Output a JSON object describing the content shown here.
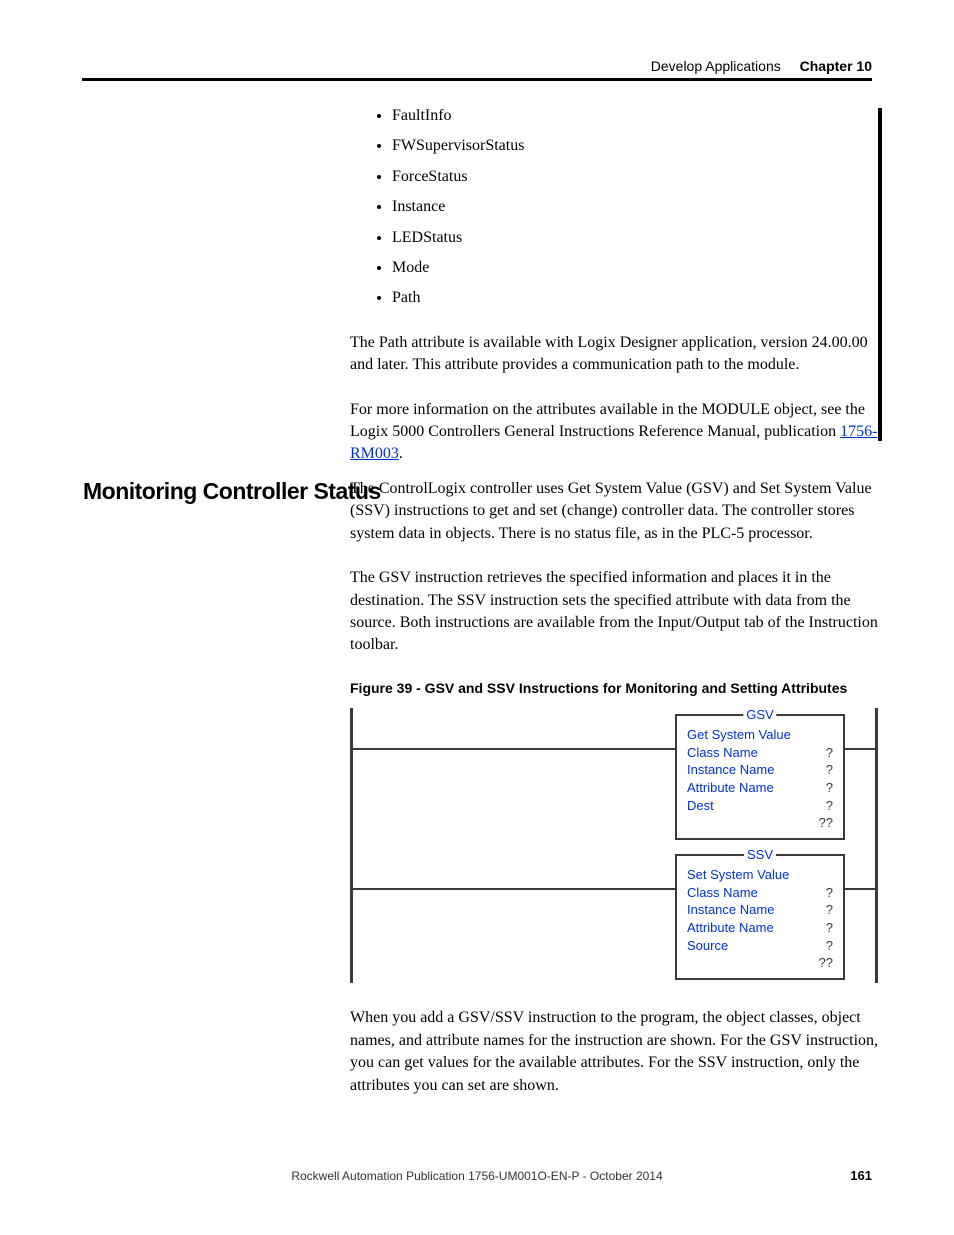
{
  "header": {
    "chapter_title": "Develop Applications",
    "chapter_label": "Chapter 10"
  },
  "attributes_list": [
    "FaultInfo",
    "FWSupervisorStatus",
    "ForceStatus",
    "Instance",
    "LEDStatus",
    "Mode",
    "Path"
  ],
  "para_path": "The Path attribute is available with Logix Designer application, version 24.00.00 and later. This attribute provides a communication path to the module.",
  "para_moreinfo_pre": "For more information on the attributes available in the MODULE object, see the Logix 5000 Controllers General Instructions Reference Manual, publication ",
  "link_text": "1756-RM003",
  "para_moreinfo_post": ".",
  "section_heading": "Monitoring Controller Status",
  "para_s2_1": "The ControlLogix controller uses Get System Value (GSV) and Set System Value (SSV) instructions to get and set (change) controller data. The controller stores system data in objects. There is no status file, as in the PLC-5 processor.",
  "para_s2_2": "The GSV instruction retrieves the specified information and places it in the destination. The SSV instruction sets the specified attribute with data from the source. Both instructions are available from the Input/Output tab of the Instruction toolbar.",
  "fig_caption": "Figure 39 - GSV and SSV Instructions for Monitoring and Setting Attributes",
  "gsv": {
    "tag": "GSV",
    "title": "Get System Value",
    "rows": [
      {
        "k": "Class Name",
        "v": "?"
      },
      {
        "k": "Instance Name",
        "v": "?"
      },
      {
        "k": "Attribute Name",
        "v": "?"
      },
      {
        "k": "Dest",
        "v": "?"
      },
      {
        "k": "",
        "v": "??"
      }
    ]
  },
  "ssv": {
    "tag": "SSV",
    "title": "Set System Value",
    "rows": [
      {
        "k": "Class Name",
        "v": "?"
      },
      {
        "k": "Instance Name",
        "v": "?"
      },
      {
        "k": "Attribute Name",
        "v": "?"
      },
      {
        "k": "Source",
        "v": "?"
      },
      {
        "k": "",
        "v": "??"
      }
    ]
  },
  "para_after_fig": "When you add a GSV/SSV instruction to the program, the object classes, object names, and attribute names for the instruction are shown. For the GSV instruction, you can get values for the available attributes. For the SSV instruction, only the attributes you can set are shown.",
  "footer": {
    "pub": "Rockwell Automation Publication 1756-UM001O-EN-P - October 2014",
    "page": "161"
  }
}
